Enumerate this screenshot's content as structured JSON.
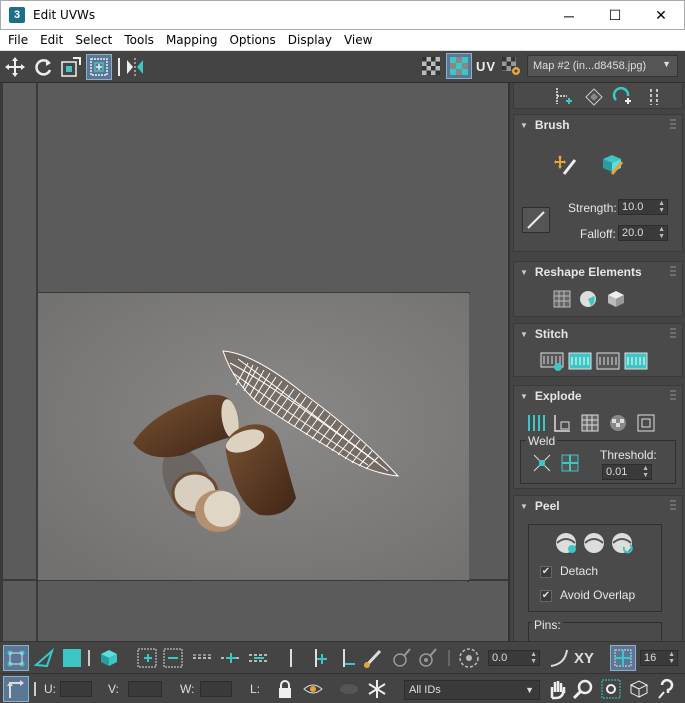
{
  "window": {
    "title": "Edit UVWs",
    "app_icon": "3",
    "minimize": "─",
    "maximize": "☐",
    "close": "✕"
  },
  "menu": [
    "File",
    "Edit",
    "Select",
    "Tools",
    "Mapping",
    "Options",
    "Display",
    "View"
  ],
  "toolbar": {
    "uv_label": "UV",
    "map_select": "Map #2 (in...d8458.jpg)"
  },
  "brush": {
    "title": "Brush",
    "strength_label": "Strength:",
    "strength_value": "10.0",
    "falloff_label": "Falloff:",
    "falloff_value": "20.0"
  },
  "reshape": {
    "title": "Reshape Elements"
  },
  "stitch": {
    "title": "Stitch"
  },
  "explode": {
    "title": "Explode",
    "weld_label": "Weld",
    "threshold_label": "Threshold:",
    "threshold_value": "0.01"
  },
  "peel": {
    "title": "Peel",
    "detach_label": "Detach",
    "avoid_overlap_label": "Avoid Overlap",
    "pins_label": "Pins:"
  },
  "bottom": {
    "rotate_value": "0.0",
    "xy_label": "XY",
    "grid_value": "16",
    "u_label": "U:",
    "v_label": "V:",
    "w_label": "W:",
    "l_label": "L:",
    "ids_select": "All IDs"
  },
  "colors": {
    "accent": "#3cc6c6",
    "active_btn": "#5a7896",
    "panel_bg": "#444444"
  }
}
